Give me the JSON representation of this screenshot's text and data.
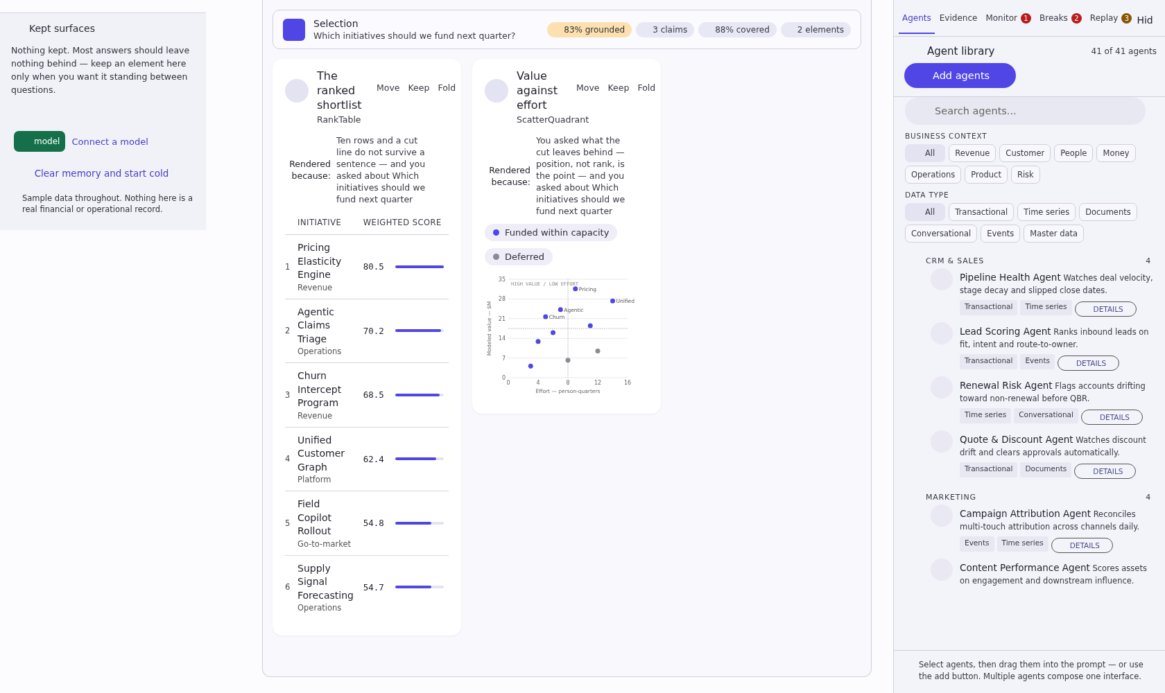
{
  "left_panel": {
    "title": "Kept surfaces",
    "body": "Nothing kept. Most answers should leave nothing behind — keep an element here only when you want it standing between questions.",
    "model_chip": "model",
    "connect_link": "Connect a model",
    "clear_link": "Clear memory and start cold",
    "note": "Sample data throughout. Nothing here is a real financial or operational record."
  },
  "selection": {
    "title": "Selection",
    "question": "Which initiatives should we fund next quarter?",
    "stats": [
      {
        "text": "83% grounded",
        "kind": "warning"
      },
      {
        "text": "3 claims",
        "kind": "neutral"
      },
      {
        "text": "88% covered",
        "kind": "neutral"
      },
      {
        "text": "2 elements",
        "kind": "neutral"
      }
    ]
  },
  "cards": [
    {
      "kind": "table",
      "title": "The ranked shortlist",
      "component": "RankTable",
      "actions": [
        "Move",
        "Keep",
        "Fold"
      ],
      "reason_label": "Rendered because:",
      "reason": "Ten rows and a cut line do not survive a sentence — and you asked about Which initiatives should we fund next quarter",
      "columns": [
        "INITIATIVE",
        "WEIGHTED SCORE"
      ],
      "rows": [
        {
          "rank": "1",
          "name": "Pricing Elasticity Engine",
          "category": "Revenue",
          "score": "80.5",
          "level": 1.0
        },
        {
          "rank": "2",
          "name": "Agentic Claims Triage",
          "category": "Operations",
          "score": "70.2",
          "level": 0.94
        },
        {
          "rank": "3",
          "name": "Churn Intercept Program",
          "category": "Revenue",
          "score": "68.5",
          "level": 0.91
        },
        {
          "rank": "4",
          "name": "Unified Customer Graph",
          "category": "Platform",
          "score": "62.4",
          "level": 0.84
        },
        {
          "rank": "5",
          "name": "Field Copilot Rollout",
          "category": "Go-to-market",
          "score": "54.8",
          "level": 0.73
        },
        {
          "rank": "6",
          "name": "Supply Signal Forecasting",
          "category": "Operations",
          "score": "54.7",
          "level": 0.73
        }
      ]
    },
    {
      "kind": "scatter",
      "title": "Value against effort",
      "component": "ScatterQuadrant",
      "actions": [
        "Move",
        "Keep",
        "Fold"
      ],
      "reason_label": "Rendered because:",
      "reason": "You asked what the cut leaves behind — position, not rank, is the point — and you asked about Which initiatives should we fund next quarter",
      "chart_data": {
        "type": "scatter",
        "xlabel": "Effort — person-quarters",
        "ylabel": "Modeled value — $M",
        "xlim": [
          0,
          16
        ],
        "ylim": [
          0,
          35
        ],
        "xticks": [
          0,
          4,
          8,
          12,
          16
        ],
        "yticks": [
          0,
          7,
          14,
          21,
          28,
          35
        ],
        "x": [
          9,
          14,
          7,
          5,
          11,
          6,
          4,
          3,
          12,
          8
        ],
        "series": [
          {
            "name": "Funded within capacity",
            "color": "#4f46e5",
            "values": [
              31.6,
              27.3,
              24.2,
              21.7,
              18.5,
              16.0,
              12.9,
              4.1,
              null,
              null
            ]
          },
          {
            "name": "Deferred",
            "color": "#8a8a92",
            "values": [
              null,
              null,
              null,
              null,
              null,
              null,
              null,
              null,
              9.5,
              6.2
            ]
          }
        ],
        "grid": true,
        "ref_lines": [
          {
            "axis": "x",
            "value": 8
          },
          {
            "axis": "y",
            "value": 17.5
          }
        ],
        "annotations": [
          {
            "text": "HIGH VALUE / LOW EFFORT"
          },
          {
            "text": "Pricing",
            "x": 9,
            "y": 31.6
          },
          {
            "text": "Unified",
            "x": 14,
            "y": 27.3
          },
          {
            "text": "Agentic",
            "x": 7,
            "y": 24.2
          },
          {
            "text": "Churn",
            "x": 5,
            "y": 21.7
          }
        ]
      }
    }
  ],
  "sidebar": {
    "tabs": [
      {
        "label": "Agents",
        "selected": true
      },
      {
        "label": "Evidence",
        "selected": false
      },
      {
        "label": "Monitor",
        "selected": false,
        "badge": "1",
        "color": "#b91c1c"
      },
      {
        "label": "Breaks",
        "selected": false,
        "badge": "2",
        "color": "#b91c1c"
      },
      {
        "label": "Replay",
        "selected": false,
        "badge": "3",
        "color": "#8a5500"
      }
    ],
    "hide": "Hid",
    "title": "Agent library",
    "count": "41 of 41 agents",
    "add_button": "Add agents",
    "search": {
      "placeholder": "Search agents..."
    },
    "filters": [
      {
        "label": "BUSINESS CONTEXT",
        "chips": [
          {
            "label": "All",
            "selected": true
          },
          {
            "label": "Revenue",
            "selected": false
          },
          {
            "label": "Customer",
            "selected": false
          },
          {
            "label": "People",
            "selected": false
          },
          {
            "label": "Money",
            "selected": false
          },
          {
            "label": "Operations",
            "selected": false
          },
          {
            "label": "Product",
            "selected": false
          },
          {
            "label": "Risk",
            "selected": false
          }
        ]
      },
      {
        "label": "DATA TYPE",
        "chips": [
          {
            "label": "All",
            "selected": true
          },
          {
            "label": "Transactional",
            "selected": false
          },
          {
            "label": "Time series",
            "selected": false
          },
          {
            "label": "Documents",
            "selected": false
          },
          {
            "label": "Conversational",
            "selected": false
          },
          {
            "label": "Events",
            "selected": false
          },
          {
            "label": "Master data",
            "selected": false
          }
        ]
      }
    ],
    "groups": [
      {
        "name": "CRM & SALES",
        "count": "4",
        "agents": [
          {
            "name": "Pipeline Health Agent",
            "description": "Watches deal velocity, stage decay and slipped close dates.",
            "tags": [
              "Transactional",
              "Time series"
            ],
            "action": "DETAILS"
          },
          {
            "name": "Lead Scoring Agent",
            "description": "Ranks inbound leads on fit, intent and route-to-owner.",
            "tags": [
              "Transactional",
              "Events"
            ],
            "action": "DETAILS"
          },
          {
            "name": "Renewal Risk Agent",
            "description": "Flags accounts drifting toward non-renewal before QBR.",
            "tags": [
              "Time series",
              "Conversational"
            ],
            "action": "DETAILS"
          },
          {
            "name": "Quote & Discount Agent",
            "description": "Watches discount drift and clears approvals automatically.",
            "tags": [
              "Transactional",
              "Documents"
            ],
            "action": "DETAILS"
          }
        ]
      },
      {
        "name": "MARKETING",
        "count": "4",
        "agents": [
          {
            "name": "Campaign Attribution Agent",
            "description": "Reconciles multi-touch attribution across channels daily.",
            "tags": [
              "Events",
              "Time series"
            ],
            "action": "DETAILS"
          },
          {
            "name": "Content Performance Agent",
            "description": "Scores assets on engagement and downstream influence."
          }
        ]
      }
    ],
    "footer": "Select agents, then drag them into the prompt — or use the add button. Multiple agents compose one interface."
  }
}
